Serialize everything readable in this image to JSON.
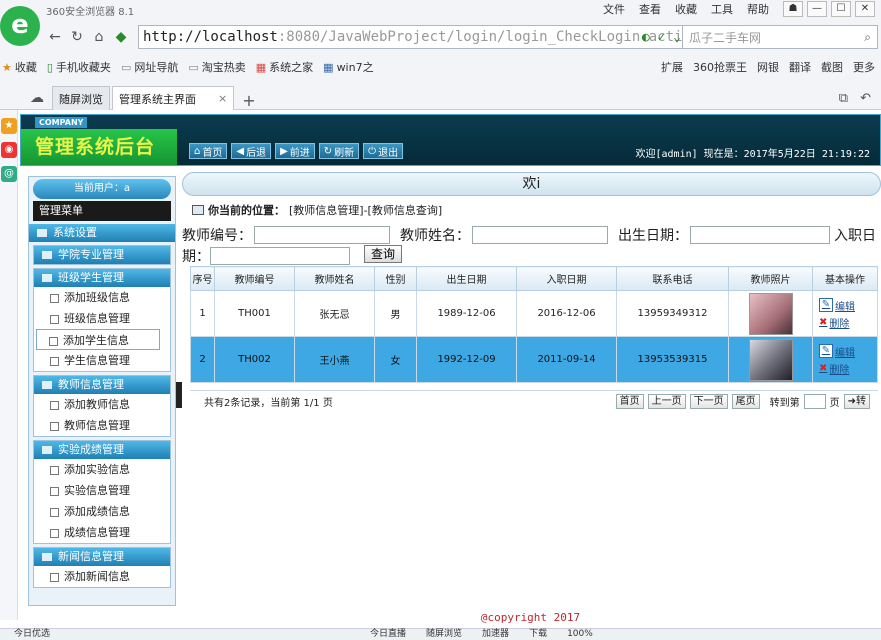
{
  "browser": {
    "title": "360安全浏览器 8.1",
    "menu": [
      "文件",
      "查看",
      "收藏",
      "工具",
      "帮助"
    ],
    "window_buttons": [
      "☗",
      "—",
      "☐",
      "✕"
    ],
    "url_host": "http://localhost",
    "url_path": ":8080/JavaWebProject/login/login_CheckLogin.action",
    "search_text": "瓜子二手车网",
    "bookmarks": [
      "收藏",
      "手机收藏夹",
      "网址导航",
      "淘宝热卖",
      "系统之家",
      "win7之"
    ],
    "bookmarks_right": [
      "扩展",
      "360抢票王",
      "网银",
      "翻译",
      "截图",
      "更多"
    ],
    "tabs": [
      "随屏浏览",
      "管理系统主界面"
    ],
    "status_items": [
      "今日优选",
      "今日直播",
      "随屏浏览",
      "加速器",
      "下载",
      "100%"
    ]
  },
  "app": {
    "company": "COMPANY",
    "title": "管理系统后台",
    "nav": [
      "首页",
      "后退",
      "前进",
      "刷新",
      "退出"
    ],
    "welcome": "欢迎[admin]   现在是：2017年5月22日 21:19:22",
    "welcome_bar": "欢i",
    "footer": "@copyright 2017"
  },
  "sidebar": {
    "current_user": "当前用户：a",
    "menu_title": "管理菜单",
    "system_settings": "系统设置",
    "groups": [
      {
        "title": "学院专业管理",
        "items": []
      },
      {
        "title": "班级学生管理",
        "items": [
          "添加班级信息",
          "班级信息管理",
          "添加学生信息",
          "学生信息管理"
        ]
      },
      {
        "title": "教师信息管理",
        "items": [
          "添加教师信息",
          "教师信息管理"
        ]
      },
      {
        "title": "实验成绩管理",
        "items": [
          "添加实验信息",
          "实验信息管理",
          "添加成绩信息",
          "成绩信息管理"
        ]
      },
      {
        "title": "新闻信息管理",
        "items": [
          "添加新闻信息"
        ]
      }
    ]
  },
  "content": {
    "location_label": "你当前的位置：",
    "location_path": "[教师信息管理]-[教师信息查询]",
    "filter_teacher_no": "教师编号：",
    "filter_teacher_name": "教师姓名：",
    "filter_birth": "出生日期：",
    "filter_join_1": "入职日",
    "filter_join_2": "期：",
    "query_button": "查询",
    "columns": [
      "序号",
      "教师编号",
      "教师姓名",
      "性别",
      "出生日期",
      "入职日期",
      "联系电话",
      "教师照片",
      "基本操作"
    ],
    "rows": [
      {
        "no": "1",
        "id": "TH001",
        "name": "张无忌",
        "sex": "男",
        "birth": "1989-12-06",
        "join": "2016-12-06",
        "phone": "13959349312"
      },
      {
        "no": "2",
        "id": "TH002",
        "name": "王小燕",
        "sex": "女",
        "birth": "1992-12-09",
        "join": "2011-09-14",
        "phone": "13953539315"
      }
    ],
    "op_edit": "编辑",
    "op_delete": "删除",
    "pager_info": "共有2条记录，当前第 1/1 页",
    "pager_buttons": [
      "首页",
      "上一页",
      "下一页",
      "尾页"
    ],
    "goto_label": "转到第",
    "goto_unit": "页",
    "goto_button": "转"
  }
}
